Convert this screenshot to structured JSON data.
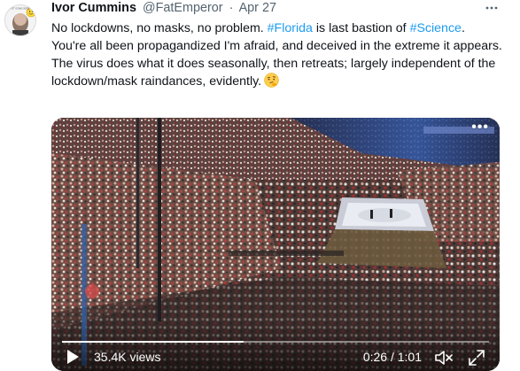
{
  "tweet": {
    "author": {
      "name": "Ivor Cummins",
      "handle": "@FatEmperor",
      "avatar_icon": "avatar-bald-man-with-smiley",
      "avatar_caption": "BEAST GONE GOOD"
    },
    "separator": "·",
    "date": "Apr 27",
    "more_icon": "more-dots-icon",
    "text": {
      "seg1": "No lockdowns, no masks, no problem. ",
      "tag1": "#Florida",
      "seg2": " is last bastion of ",
      "tag2": "#Science",
      "seg3": ".",
      "line2": "You're all been propagandized I'm afraid, and deceived in the extreme it appears.",
      "line3": "The virus does what it does seasonally, then retreats; largely independent of the lockdown/mask raindances, evidently.",
      "emoji": "thinking-face-emoji"
    },
    "hashtag_color": "#1d9bf0"
  },
  "video": {
    "more_label": "•••",
    "views": "35.4K views",
    "time": "0:26 / 1:01",
    "progress": 0.426,
    "icons": {
      "play": "play-icon",
      "mute": "volume-muted-icon",
      "fullscreen": "fullscreen-icon"
    }
  }
}
